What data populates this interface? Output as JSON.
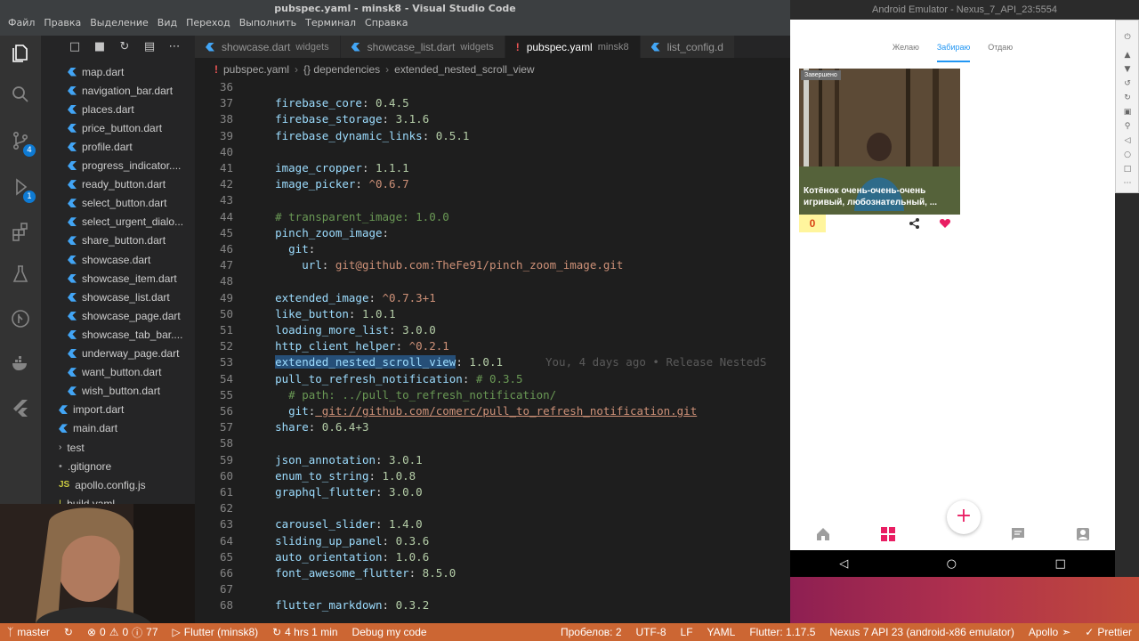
{
  "window": {
    "title": "pubspec.yaml - minsk8 - Visual Studio Code"
  },
  "menu": [
    "Файл",
    "Правка",
    "Выделение",
    "Вид",
    "Переход",
    "Выполнить",
    "Терминал",
    "Справка"
  ],
  "activity": {
    "scm_badge": "4",
    "debug_badge": "1"
  },
  "sidebar": {
    "files": [
      {
        "name": "map.dart",
        "type": "dart",
        "indent": 1
      },
      {
        "name": "navigation_bar.dart",
        "type": "dart",
        "indent": 1
      },
      {
        "name": "places.dart",
        "type": "dart",
        "indent": 1
      },
      {
        "name": "price_button.dart",
        "type": "dart",
        "indent": 1
      },
      {
        "name": "profile.dart",
        "type": "dart",
        "indent": 1
      },
      {
        "name": "progress_indicator....",
        "type": "dart",
        "indent": 1
      },
      {
        "name": "ready_button.dart",
        "type": "dart",
        "indent": 1
      },
      {
        "name": "select_button.dart",
        "type": "dart",
        "indent": 1
      },
      {
        "name": "select_urgent_dialo...",
        "type": "dart",
        "indent": 1
      },
      {
        "name": "share_button.dart",
        "type": "dart",
        "indent": 1
      },
      {
        "name": "showcase.dart",
        "type": "dart",
        "indent": 1
      },
      {
        "name": "showcase_item.dart",
        "type": "dart",
        "indent": 1
      },
      {
        "name": "showcase_list.dart",
        "type": "dart",
        "indent": 1
      },
      {
        "name": "showcase_page.dart",
        "type": "dart",
        "indent": 1
      },
      {
        "name": "showcase_tab_bar....",
        "type": "dart",
        "indent": 1
      },
      {
        "name": "underway_page.dart",
        "type": "dart",
        "indent": 1
      },
      {
        "name": "want_button.dart",
        "type": "dart",
        "indent": 1
      },
      {
        "name": "wish_button.dart",
        "type": "dart",
        "indent": 1
      },
      {
        "name": "import.dart",
        "type": "dart",
        "indent": 0
      },
      {
        "name": "main.dart",
        "type": "dart",
        "indent": 0
      },
      {
        "name": "test",
        "type": "folder",
        "indent": 0
      },
      {
        "name": ".gitignore",
        "type": "git",
        "indent": 0
      },
      {
        "name": "apollo.config.js",
        "type": "js",
        "indent": 0
      },
      {
        "name": "build.yaml",
        "type": "yaml",
        "indent": 0
      }
    ]
  },
  "tabs": [
    {
      "label": "showcase.dart",
      "sub": "widgets",
      "type": "dart",
      "active": false
    },
    {
      "label": "showcase_list.dart",
      "sub": "widgets",
      "type": "dart",
      "active": false
    },
    {
      "label": "pubspec.yaml",
      "sub": "minsk8",
      "type": "yaml",
      "active": true
    },
    {
      "label": "list_config.d",
      "sub": "",
      "type": "dart",
      "active": false
    }
  ],
  "breadcrumb": [
    "pubspec.yaml",
    "{} dependencies",
    "extended_nested_scroll_view"
  ],
  "code": [
    {
      "n": "36",
      "t": ""
    },
    {
      "n": "37",
      "t": "    firebase_core: 0.4.5"
    },
    {
      "n": "38",
      "t": "    firebase_storage: 3.1.6"
    },
    {
      "n": "39",
      "t": "    firebase_dynamic_links: 0.5.1"
    },
    {
      "n": "40",
      "t": ""
    },
    {
      "n": "41",
      "t": "    image_cropper: 1.1.1"
    },
    {
      "n": "42",
      "t": "    image_picker: ^0.6.7"
    },
    {
      "n": "43",
      "t": ""
    },
    {
      "n": "44",
      "t": "    # transparent_image: 1.0.0"
    },
    {
      "n": "45",
      "t": "    pinch_zoom_image:"
    },
    {
      "n": "46",
      "t": "      git:"
    },
    {
      "n": "47",
      "t": "        url: git@github.com:TheFe91/pinch_zoom_image.git"
    },
    {
      "n": "48",
      "t": ""
    },
    {
      "n": "49",
      "t": "    extended_image: ^0.7.3+1"
    },
    {
      "n": "50",
      "t": "    like_button: 1.0.1"
    },
    {
      "n": "51",
      "t": "    loading_more_list: 3.0.0"
    },
    {
      "n": "52",
      "t": "    http_client_helper: ^0.2.1"
    },
    {
      "n": "53",
      "t": "    extended_nested_scroll_view: 1.0.1"
    },
    {
      "n": "54",
      "t": "    pull_to_refresh_notification: # 0.3.5"
    },
    {
      "n": "55",
      "t": "      # path: ../pull_to_refresh_notification/"
    },
    {
      "n": "56",
      "t": "      git: git://github.com/comerc/pull_to_refresh_notification.git"
    },
    {
      "n": "57",
      "t": "    share: 0.6.4+3"
    },
    {
      "n": "58",
      "t": ""
    },
    {
      "n": "59",
      "t": "    json_annotation: 3.0.1"
    },
    {
      "n": "60",
      "t": "    enum_to_string: 1.0.8"
    },
    {
      "n": "61",
      "t": "    graphql_flutter: 3.0.0"
    },
    {
      "n": "62",
      "t": ""
    },
    {
      "n": "63",
      "t": "    carousel_slider: 1.4.0"
    },
    {
      "n": "64",
      "t": "    sliding_up_panel: 0.3.6"
    },
    {
      "n": "65",
      "t": "    auto_orientation: 1.0.6"
    },
    {
      "n": "66",
      "t": "    font_awesome_flutter: 8.5.0"
    },
    {
      "n": "67",
      "t": ""
    },
    {
      "n": "68",
      "t": "    flutter_markdown: 0.3.2"
    }
  ],
  "blame": "You, 4 days ago • Release NestedS",
  "emulator": {
    "title": "Android Emulator - Nexus_7_API_23:5554",
    "tabs": [
      "Желаю",
      "Забираю",
      "Отдаю"
    ],
    "active_tab": 1,
    "card_tag": "Завершено",
    "card_caption": "Котёнок очень-очень-очень игривый, любознательный, ...",
    "counter": "0",
    "fab": "+"
  },
  "status": {
    "branch": "master",
    "errors": "0",
    "warnings": "0",
    "info": "77",
    "flutter": "Flutter (minsk8)",
    "time": "4 hrs 1 min",
    "debug": "Debug my code",
    "spaces": "Пробелов: 2",
    "encoding": "UTF-8",
    "eol": "LF",
    "lang": "YAML",
    "flutter_ver": "Flutter: 1.17.5",
    "device": "Nexus 7 API 23 (android-x86 emulator)",
    "apollo": "Apollo",
    "prettier": "Prettier"
  },
  "colors": {
    "statusbar": "#cc6633",
    "accent": "#2196f3",
    "heart": "#e91e63"
  }
}
